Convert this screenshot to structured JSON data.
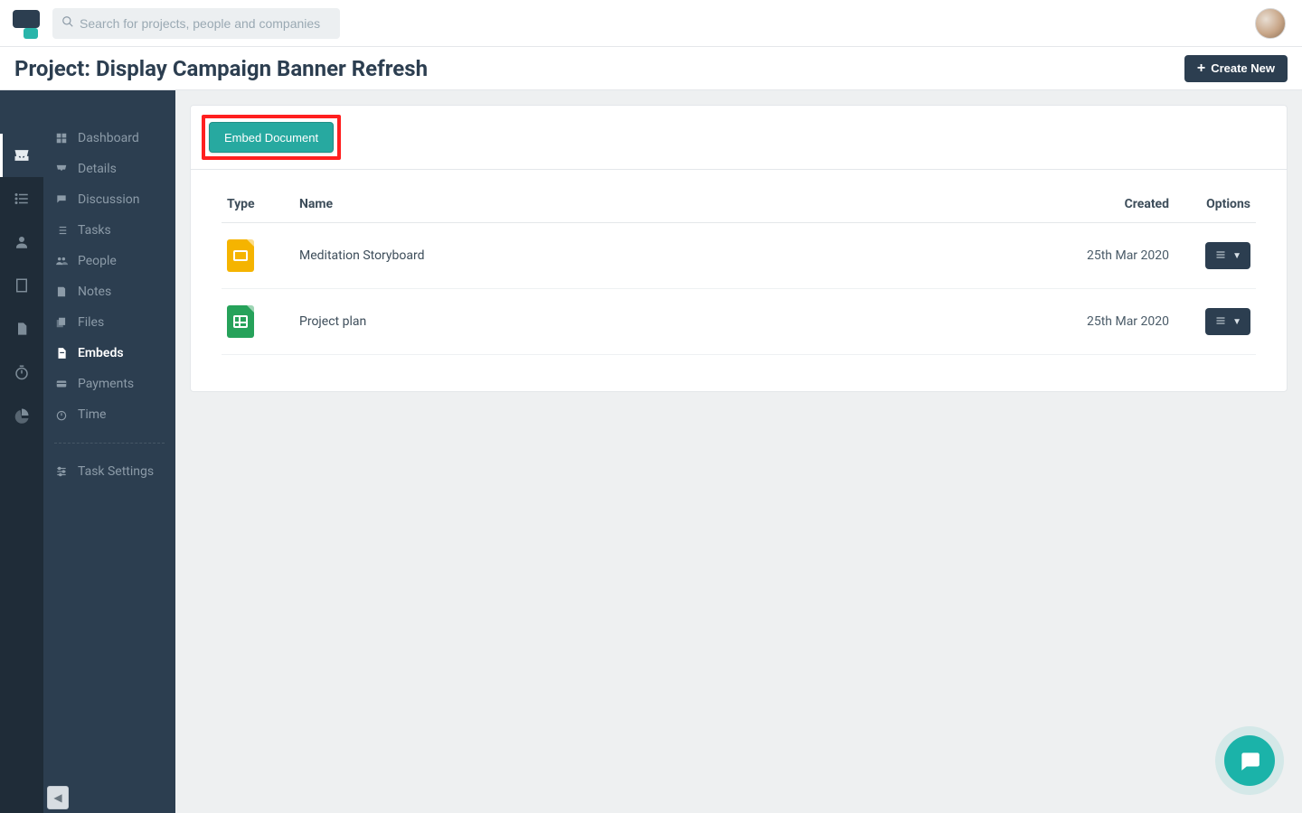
{
  "search": {
    "placeholder": "Search for projects, people and companies"
  },
  "header": {
    "title": "Project: Display Campaign Banner Refresh",
    "create_label": "Create New"
  },
  "sidebar": {
    "items": [
      {
        "label": "Dashboard"
      },
      {
        "label": "Details"
      },
      {
        "label": "Discussion"
      },
      {
        "label": "Tasks"
      },
      {
        "label": "People"
      },
      {
        "label": "Notes"
      },
      {
        "label": "Files"
      },
      {
        "label": "Embeds"
      },
      {
        "label": "Payments"
      },
      {
        "label": "Time"
      }
    ],
    "settings_label": "Task Settings"
  },
  "content": {
    "embed_button": "Embed Document",
    "columns": {
      "type": "Type",
      "name": "Name",
      "created": "Created",
      "options": "Options"
    },
    "rows": [
      {
        "name": "Meditation Storyboard",
        "created": "25th Mar 2020",
        "doc_type": "slides"
      },
      {
        "name": "Project plan",
        "created": "25th Mar 2020",
        "doc_type": "sheets"
      }
    ]
  }
}
